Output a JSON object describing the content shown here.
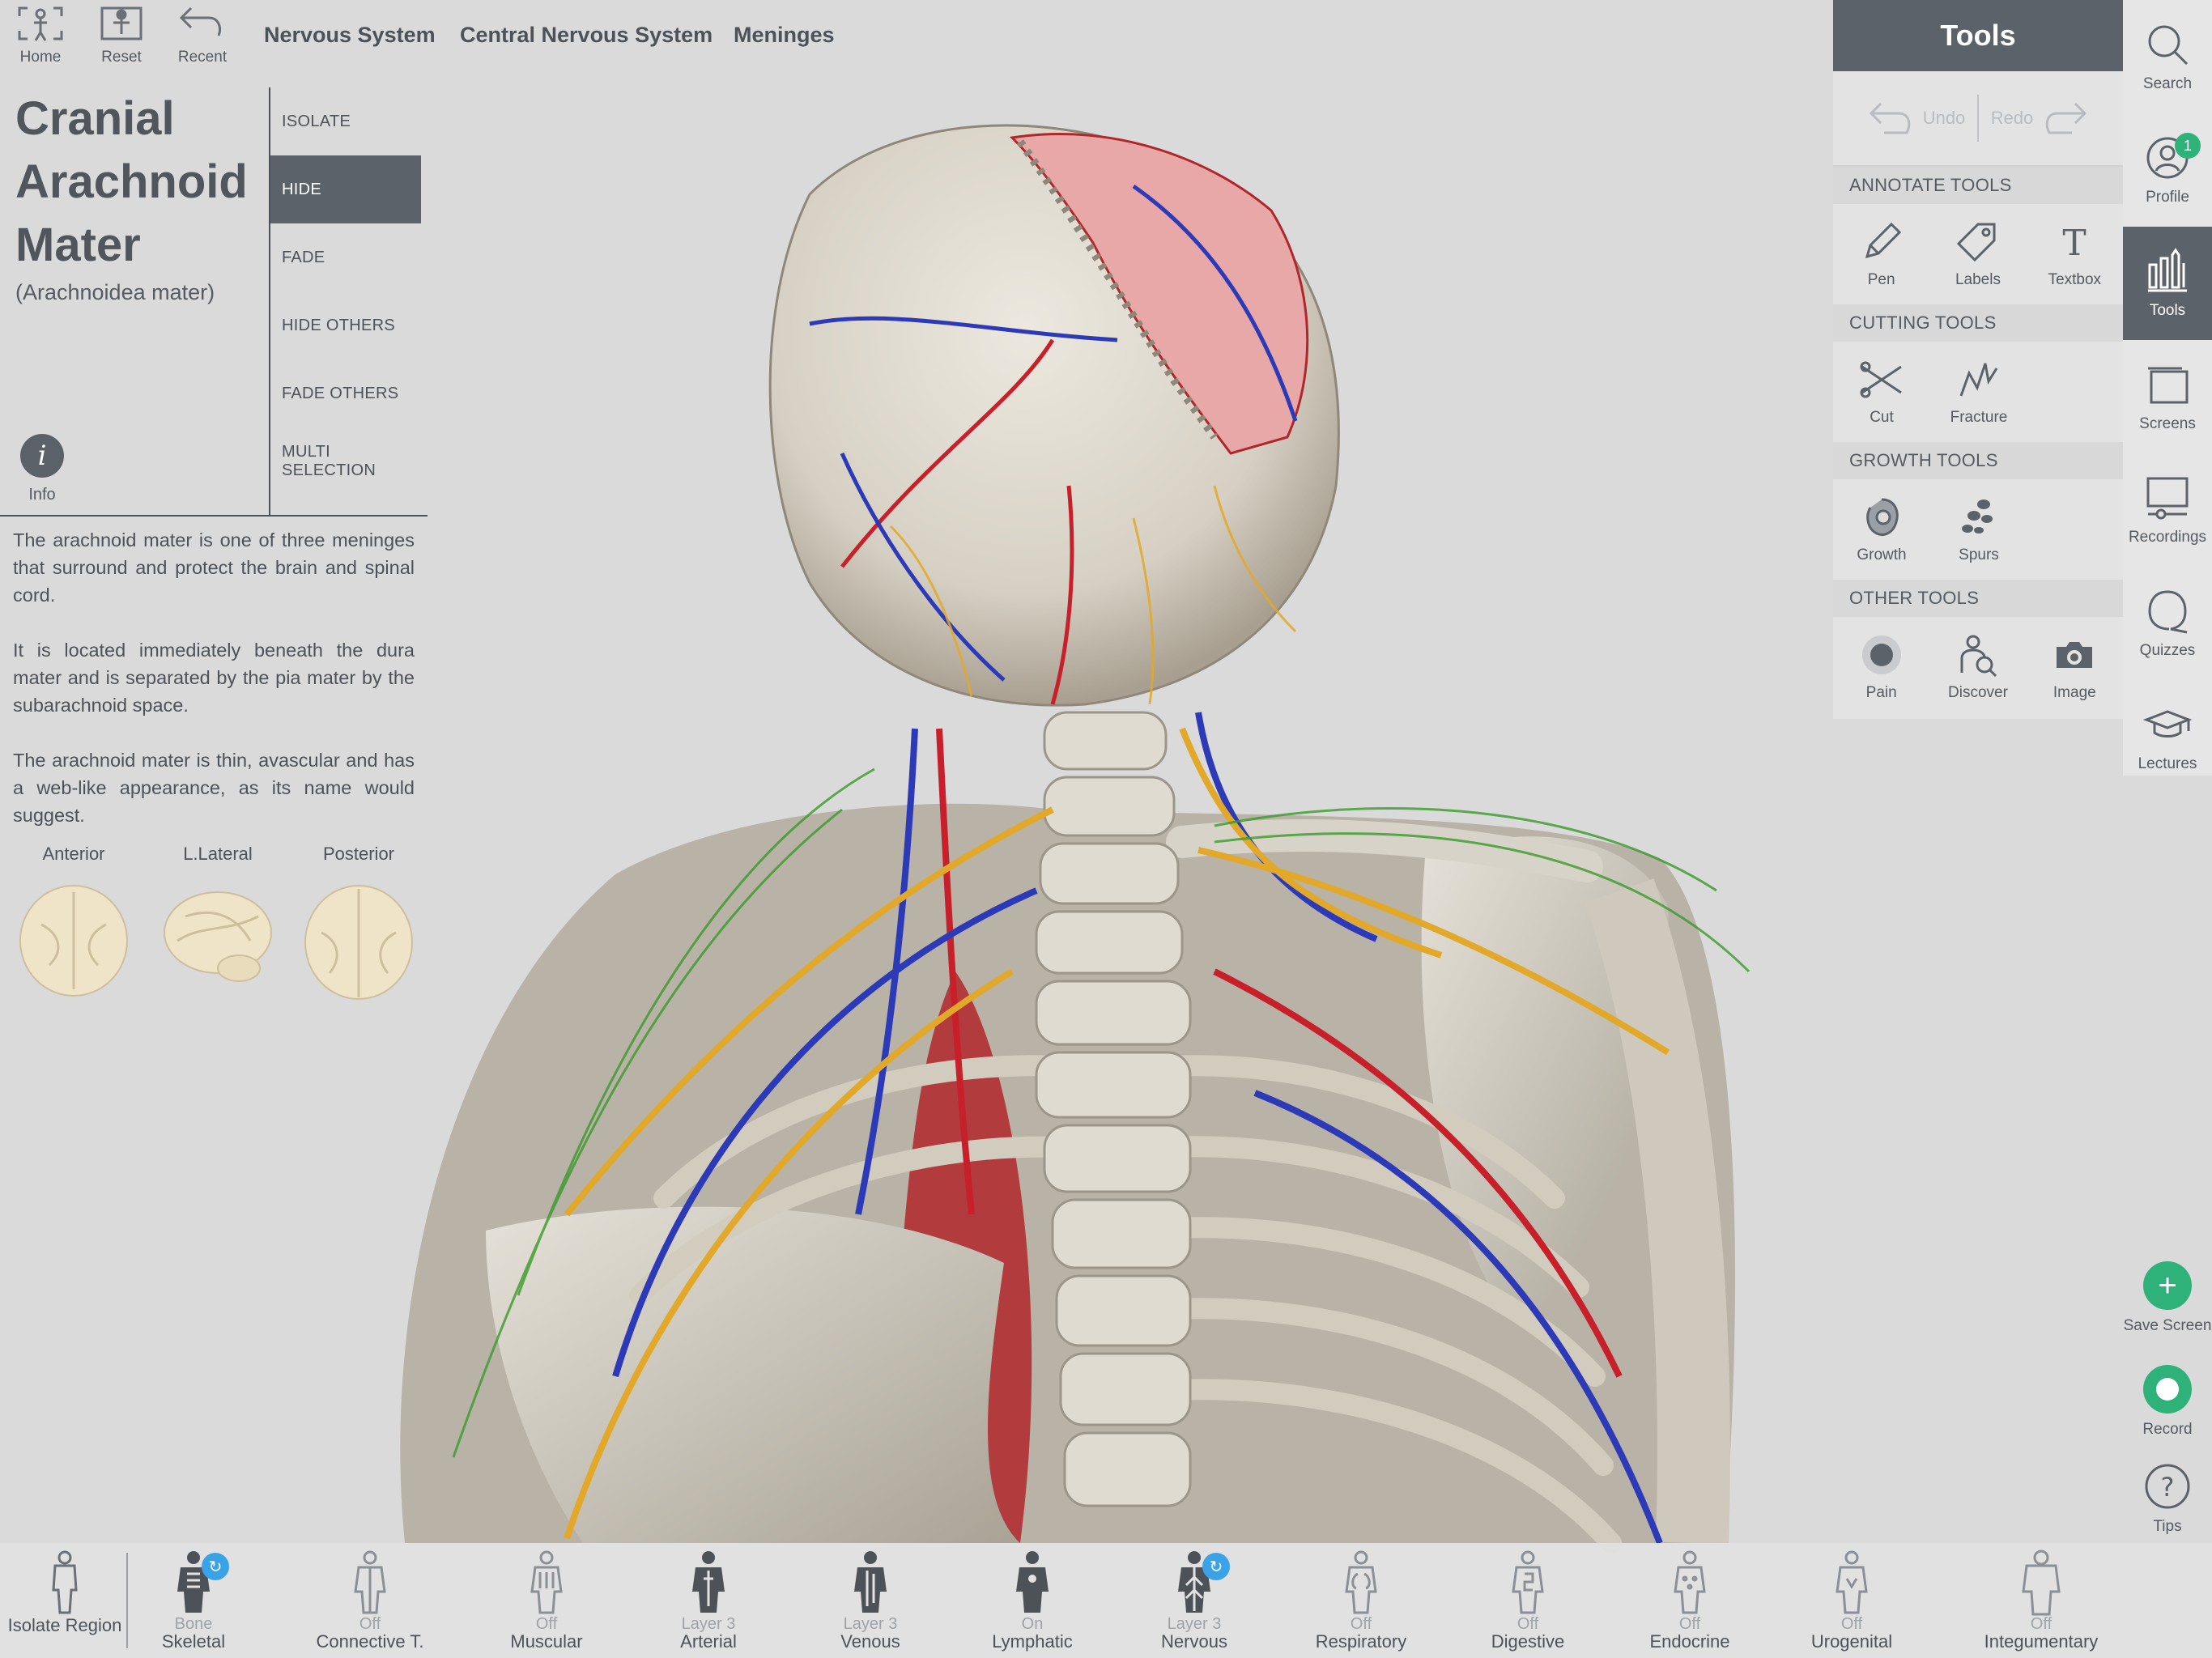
{
  "toolbar": {
    "home": "Home",
    "reset": "Reset",
    "recent": "Recent"
  },
  "breadcrumbs": [
    "Nervous System",
    "Central Nervous System",
    "Meninges"
  ],
  "structure": {
    "title": "Cranial Arachnoid Mater",
    "latin": "(Arachnoidea mater)",
    "info_label": "Info",
    "description": [
      "The arachnoid mater is one of three meninges that surround and protect the brain and spinal cord.",
      "It is located immediately beneath the dura mater and is separated by the pia mater by the subarachnoid space.",
      "The arachnoid mater is thin, avascular and has a web-like appearance, as its name would suggest."
    ],
    "views": [
      "Anterior",
      "L.Lateral",
      "Posterior"
    ]
  },
  "actions": [
    "ISOLATE",
    "HIDE",
    "FADE",
    "HIDE OTHERS",
    "FADE OTHERS",
    "MULTI SELECTION"
  ],
  "active_action": "HIDE",
  "tools": {
    "title": "Tools",
    "undo": "Undo",
    "redo": "Redo",
    "sections": [
      {
        "title": "ANNOTATE TOOLS",
        "items": [
          {
            "label": "Pen",
            "icon": "pen-icon"
          },
          {
            "label": "Labels",
            "icon": "label-tag-icon"
          },
          {
            "label": "Textbox",
            "icon": "textbox-icon"
          }
        ]
      },
      {
        "title": "CUTTING TOOLS",
        "items": [
          {
            "label": "Cut",
            "icon": "scissors-icon"
          },
          {
            "label": "Fracture",
            "icon": "fracture-icon"
          }
        ]
      },
      {
        "title": "GROWTH TOOLS",
        "items": [
          {
            "label": "Growth",
            "icon": "growth-icon"
          },
          {
            "label": "Spurs",
            "icon": "spurs-icon"
          }
        ]
      },
      {
        "title": "OTHER TOOLS",
        "items": [
          {
            "label": "Pain",
            "icon": "pain-icon"
          },
          {
            "label": "Discover",
            "icon": "discover-icon"
          },
          {
            "label": "Image",
            "icon": "camera-icon"
          }
        ]
      }
    ]
  },
  "sidebar": {
    "items": [
      {
        "label": "Search",
        "icon": "search-icon"
      },
      {
        "label": "Profile",
        "icon": "profile-icon",
        "badge": "1"
      },
      {
        "label": "Tools",
        "icon": "tools-icon",
        "active": true
      },
      {
        "label": "Screens",
        "icon": "screens-icon"
      },
      {
        "label": "Recordings",
        "icon": "recordings-icon"
      },
      {
        "label": "Quizzes",
        "icon": "quizzes-icon"
      },
      {
        "label": "Lectures",
        "icon": "lectures-icon"
      }
    ],
    "save_screen": "Save Screen",
    "record": "Record",
    "tips": "Tips"
  },
  "systems": [
    {
      "state": "",
      "name": "Isolate Region"
    },
    {
      "state": "Bone",
      "name": "Skeletal",
      "sync": true
    },
    {
      "state": "Off",
      "name": "Connective T."
    },
    {
      "state": "Off",
      "name": "Muscular"
    },
    {
      "state": "Layer 3",
      "name": "Arterial"
    },
    {
      "state": "Layer 3",
      "name": "Venous"
    },
    {
      "state": "On",
      "name": "Lymphatic"
    },
    {
      "state": "Layer 3",
      "name": "Nervous",
      "sync": true
    },
    {
      "state": "Off",
      "name": "Respiratory"
    },
    {
      "state": "Off",
      "name": "Digestive"
    },
    {
      "state": "Off",
      "name": "Endocrine"
    },
    {
      "state": "Off",
      "name": "Urogenital"
    },
    {
      "state": "Off",
      "name": "Integumentary"
    }
  ],
  "colors": {
    "panel_dark": "#5c6269",
    "accent_green": "#2fb27a",
    "sync_blue": "#3aa3e8",
    "bone": "#e2ddd2",
    "artery": "#c8202a",
    "vein": "#2c3ab8",
    "nerve": "#e2a82a",
    "lymph": "#3a9a2a"
  }
}
